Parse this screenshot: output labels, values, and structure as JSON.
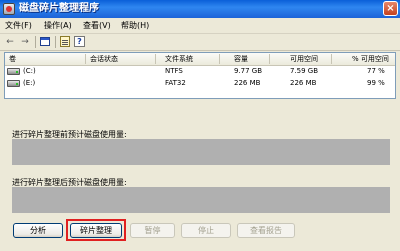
{
  "window": {
    "title": "磁盘碎片整理程序",
    "close_glyph": "×"
  },
  "menu": [
    "文件(F)",
    "操作(A)",
    "查看(V)",
    "帮助(H)"
  ],
  "toolbar": {
    "back_glyph": "←",
    "forward_glyph": "→",
    "icons": [
      "back-arrow-icon",
      "forward-arrow-icon",
      "window-icon",
      "properties-icon",
      "help-icon"
    ]
  },
  "volume_list": {
    "columns": [
      "卷",
      "会话状态",
      "文件系统",
      "容量",
      "可用空间",
      "% 可用空间"
    ],
    "rows": [
      {
        "volume": "(C:)",
        "session_status": "",
        "file_system": "NTFS",
        "capacity": "9.77 GB",
        "free_space": "7.59 GB",
        "percent_free": "77 %"
      },
      {
        "volume": "(E:)",
        "session_status": "",
        "file_system": "FAT32",
        "capacity": "226 MB",
        "free_space": "226 MB",
        "percent_free": "99 %"
      }
    ]
  },
  "panels": {
    "before_label": "进行碎片整理前预计磁盘使用量:",
    "after_label": "进行碎片整理后预计磁盘使用量:"
  },
  "buttons": {
    "analyze": "分析",
    "defragment": "碎片整理",
    "pause": "暂停",
    "stop": "停止",
    "view_report": "查看报告"
  },
  "colors": {
    "titlebar": "#2f86f0",
    "highlight": "#e02020",
    "panel": "#b0b0b0"
  }
}
